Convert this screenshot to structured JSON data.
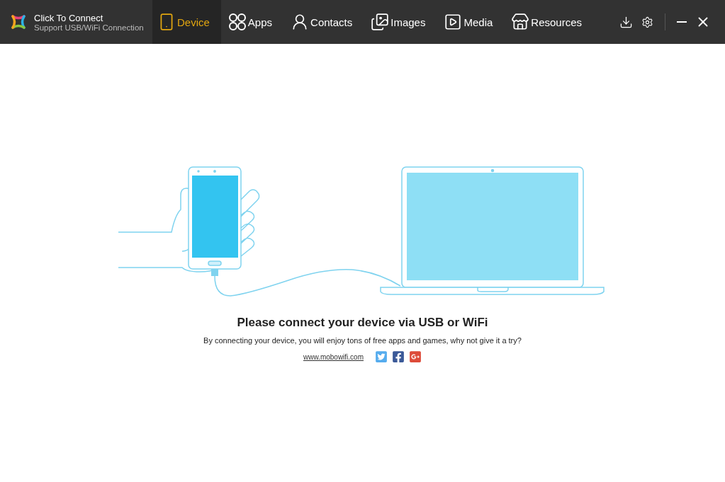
{
  "app": {
    "title": "Click To Connect",
    "subtitle": "Support USB/WiFi Connection"
  },
  "tabs": [
    {
      "kind": "device",
      "label": "Device",
      "selected": true
    },
    {
      "kind": "apps",
      "label": "Apps",
      "selected": false
    },
    {
      "kind": "contacts",
      "label": "Contacts",
      "selected": false
    },
    {
      "kind": "images",
      "label": "Images",
      "selected": false
    },
    {
      "kind": "media",
      "label": "Media",
      "selected": false
    },
    {
      "kind": "resources",
      "label": "Resources",
      "selected": false
    }
  ],
  "message": {
    "heading": "Please connect your device via USB or WiFi",
    "body": "By connecting your device, you will enjoy tons of free apps and games, why not give it a try?",
    "link": "www.mobowifi.com"
  },
  "social": [
    {
      "kind": "twitter",
      "color": "#55acee"
    },
    {
      "kind": "facebook",
      "color": "#3b5998"
    },
    {
      "kind": "google",
      "color": "#dd4b39"
    }
  ]
}
